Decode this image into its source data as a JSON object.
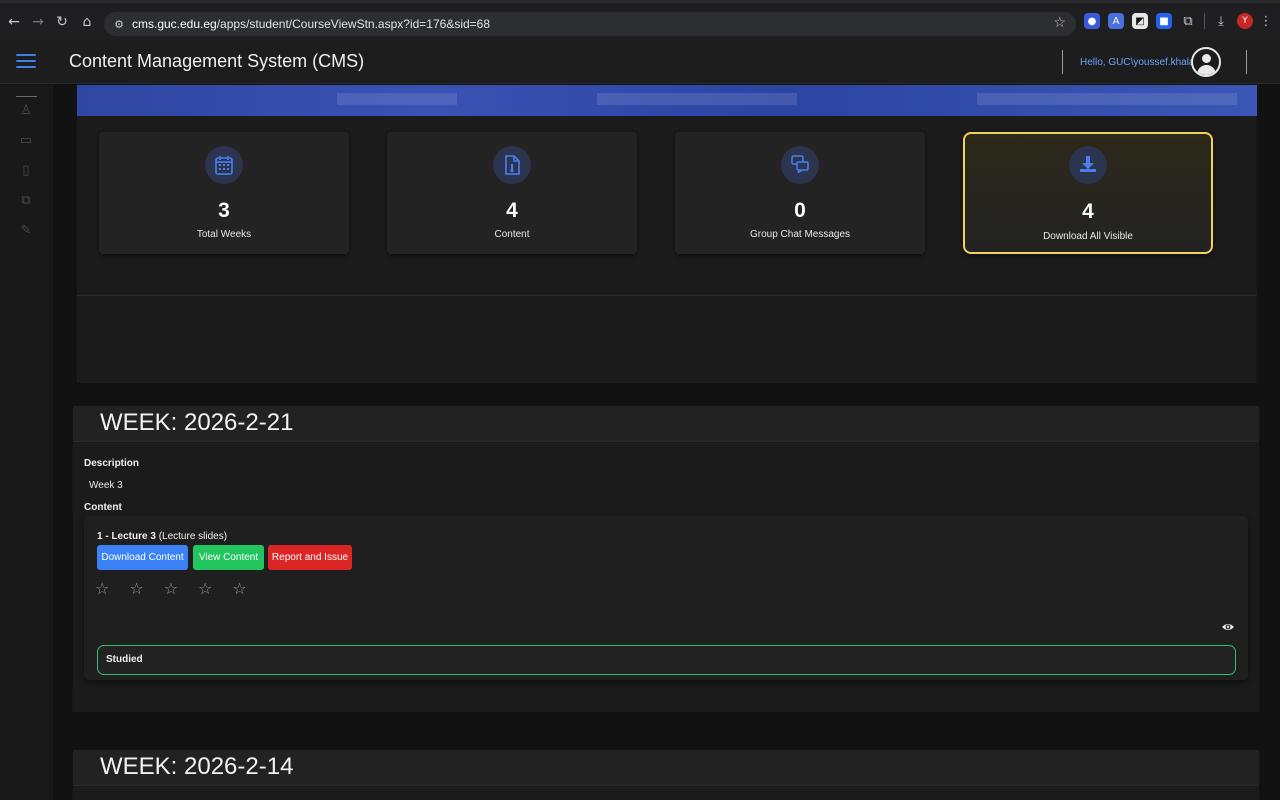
{
  "browser": {
    "url_host": "cms.guc.edu.eg",
    "url_path": "/apps/student/CourseViewStn.aspx?id=176&sid=68",
    "profile_initial": "Y"
  },
  "app": {
    "title": "Content Management System (CMS)",
    "greeting": "Hello, GUC\\youssef.khalaf"
  },
  "stats": [
    {
      "value": "3",
      "label": "Total Weeks",
      "icon": "calendar-icon"
    },
    {
      "value": "4",
      "label": "Content",
      "icon": "file-icon"
    },
    {
      "value": "0",
      "label": "Group Chat Messages",
      "icon": "chat-icon"
    },
    {
      "value": "4",
      "label": "Download All Visible",
      "icon": "download-icon"
    }
  ],
  "weeks": [
    {
      "title": "WEEK: 2026-2-21",
      "description_label": "Description",
      "description": "Week 3",
      "content_label": "Content",
      "items": [
        {
          "title": "1 - Lecture 3",
          "type": "(Lecture slides)",
          "download_label": "Download Content",
          "view_label": "View Content",
          "report_label": "Report and Issue",
          "rating": 0,
          "rating_max": 5,
          "status": "Studied"
        }
      ]
    },
    {
      "title": "WEEK: 2026-2-14"
    }
  ],
  "colors": {
    "accent": "#3d7eea",
    "download_btn": "#3b82f6",
    "view_btn": "#22c55e",
    "report_btn": "#dc2626",
    "highlight_border": "#f2d35a",
    "studied_border": "#2fbf71"
  }
}
